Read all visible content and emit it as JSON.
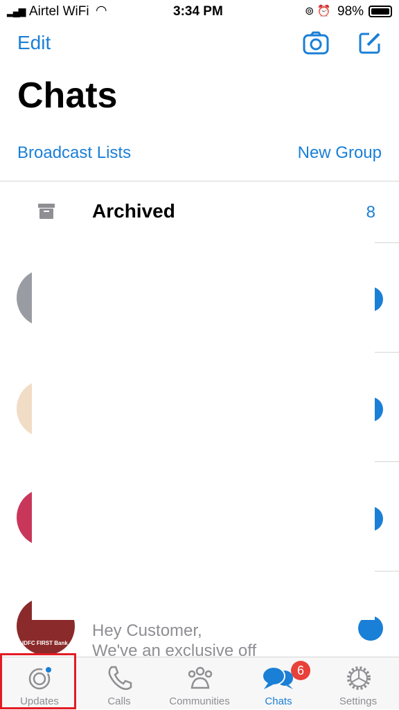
{
  "status_bar": {
    "carrier": "Airtel WiFi",
    "time": "3:34 PM",
    "battery": "98%"
  },
  "header": {
    "edit": "Edit",
    "title": "Chats",
    "camera_icon": "camera-icon",
    "compose_icon": "compose-icon"
  },
  "links": {
    "broadcast": "Broadcast Lists",
    "new_group": "New Group"
  },
  "archived": {
    "label": "Archived",
    "count": "8"
  },
  "chats": [
    {
      "avatar_color": "#9a9ca3"
    },
    {
      "avatar_color": "#f1dcc6"
    },
    {
      "avatar_color": "#c8375a"
    },
    {
      "avatar_color": "#8b2a2a",
      "avatar_text": "IDFC FIRST Bank",
      "preview_line1": "Hey Customer,",
      "preview_line2": "We've an exclusive off"
    }
  ],
  "tabs": [
    {
      "label": "Updates",
      "icon": "updates-icon"
    },
    {
      "label": "Calls",
      "icon": "phone-icon"
    },
    {
      "label": "Communities",
      "icon": "communities-icon"
    },
    {
      "label": "Chats",
      "icon": "chats-icon",
      "badge": "6",
      "active": true
    },
    {
      "label": "Settings",
      "icon": "gear-icon"
    }
  ],
  "colors": {
    "accent": "#1a7fd6",
    "badge": "#e8403a",
    "highlight": "#e21b23"
  }
}
